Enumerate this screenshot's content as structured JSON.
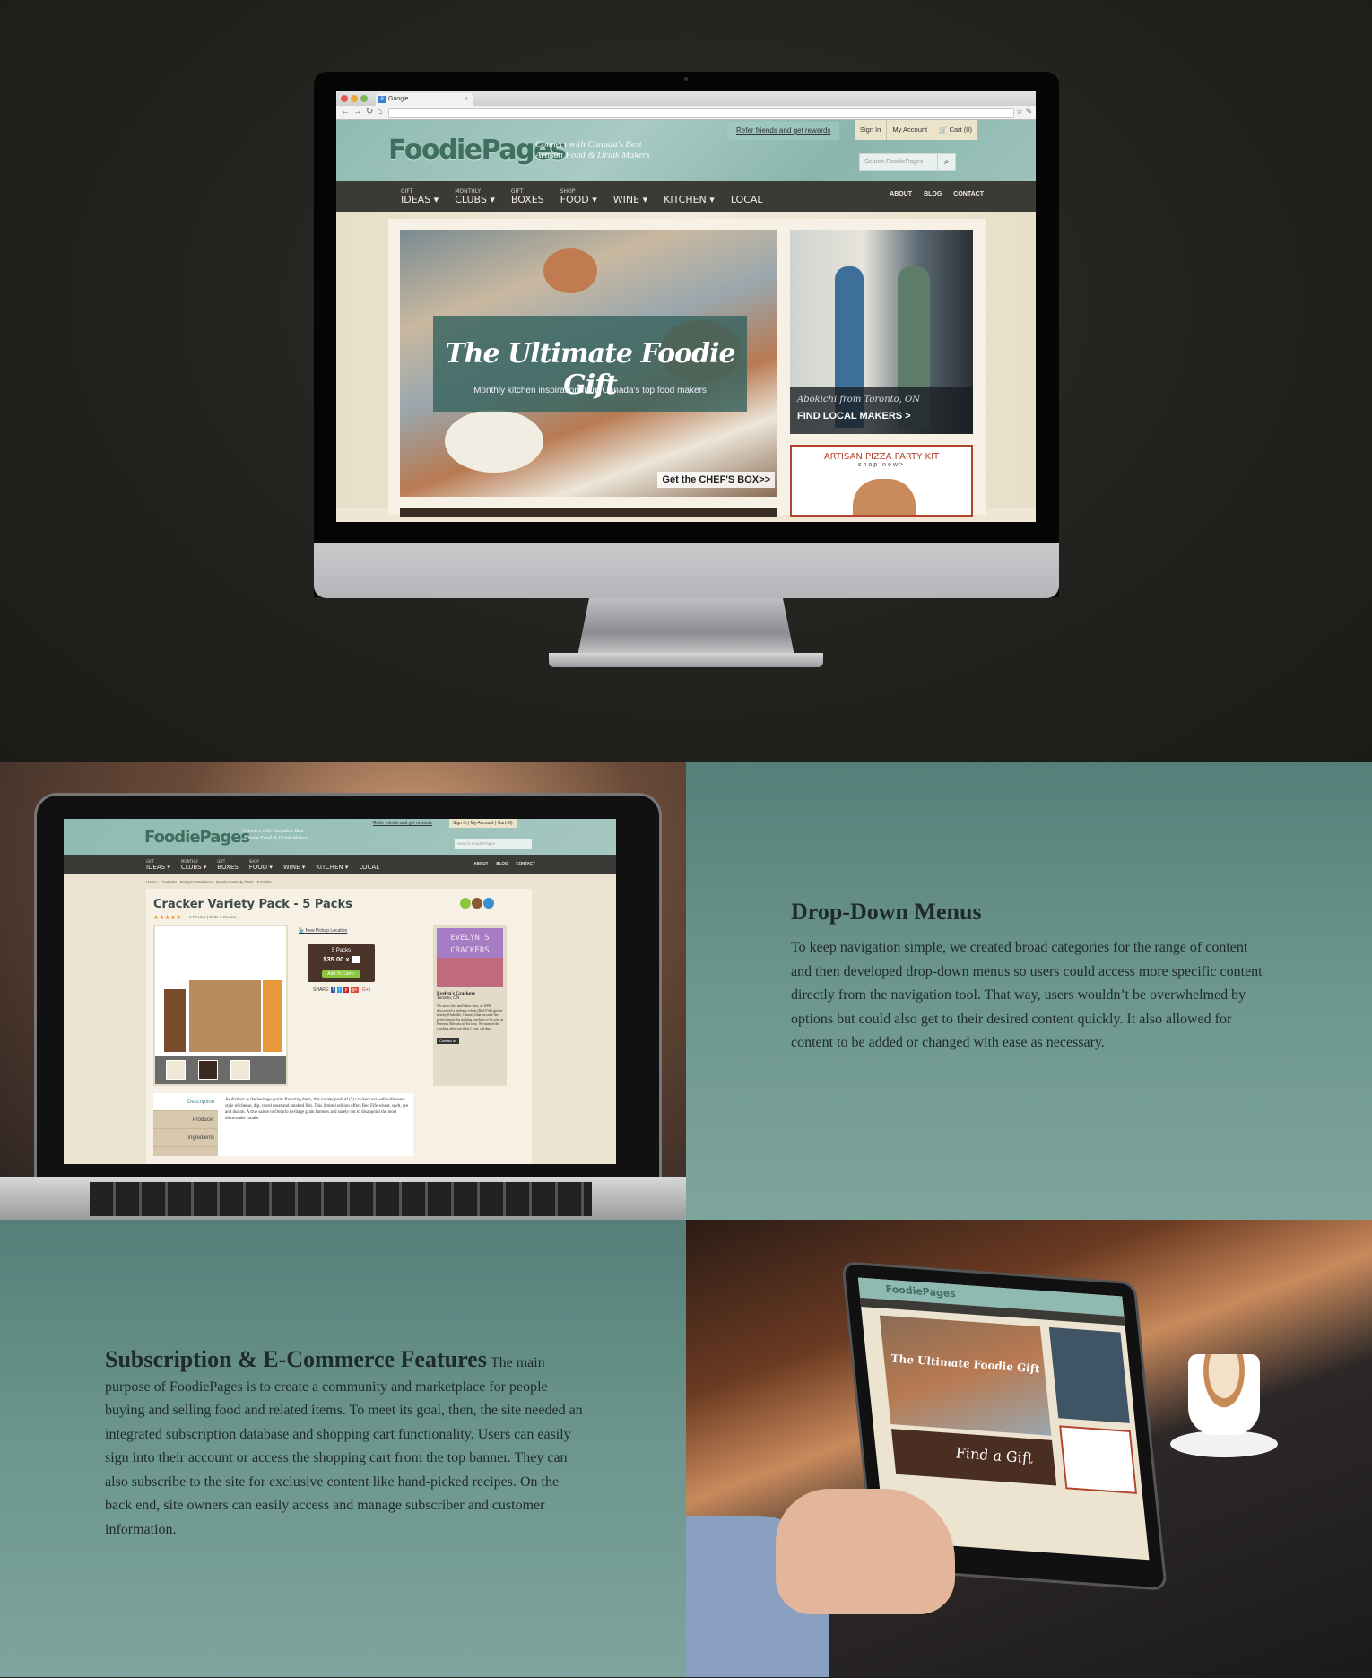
{
  "browser": {
    "tab_title": "Google",
    "tab_icon": "google-favicon",
    "nav_buttons": [
      "back-icon",
      "forward-icon",
      "reload-icon",
      "home-icon"
    ],
    "url": ""
  },
  "site": {
    "logo": "FoodiePages",
    "tagline_line1": "Connect with Canada's Best",
    "tagline_line2": "Artisan Food & Drink Makers",
    "refer_link": "Refer friends and get rewards",
    "account_links": [
      "Sign In",
      "My Account",
      "Cart (0)"
    ],
    "cart_icon": "cart-icon",
    "search_placeholder": "Search FoodiePages",
    "nav": [
      {
        "small": "GIFT",
        "label": "IDEAS ▾"
      },
      {
        "small": "MONTHLY",
        "label": "CLUBS ▾"
      },
      {
        "small": "GIFT",
        "label": "BOXES"
      },
      {
        "small": "SHOP",
        "label": "FOOD ▾"
      },
      {
        "small": "",
        "label": "WINE ▾"
      },
      {
        "small": "",
        "label": "KITCHEN ▾"
      },
      {
        "small": "",
        "label": "LOCAL"
      }
    ],
    "nav_right": [
      "ABOUT",
      "BLOG",
      "CONTACT"
    ]
  },
  "hero": {
    "title": "The Ultimate Foodie Gift",
    "subtitle": "Monthly kitchen inspiration from Canada's top food makers",
    "cta": "Get the CHEF'S BOX>>"
  },
  "makers": {
    "script": "Abokichi from Toronto, ON",
    "cta": "FIND LOCAL MAKERS >"
  },
  "pizza": {
    "title": "ARTISAN PIZZA PARTY KIT",
    "sub": "shop now>"
  },
  "product_page": {
    "breadcrumb": "Home › Products › Evelyn's Crackers › Cracker Variety Pack - 5 Packs",
    "title": "Cracker Variety Pack - 5 Packs",
    "stars": "★★★★★",
    "rating": 5,
    "reviews": "1 Review | Write a Review",
    "pickup": "New Pickup Location",
    "tag_packs": "5 Packs",
    "price": "$35.00 x",
    "add_to_cart": "Add To Cart »",
    "share_label": "SHARE:",
    "producer_logo": "EVELYN'S CRACKERS",
    "producer_name": "Evelyn's Crackers",
    "producer_location": "Toronto, ON",
    "producer_desc": "We are a chef and baker who, in 2008, discovered a heritage wheat (Red Fife) grown nearby (Oakville, Ontario) that became the perfect muse for making crackers to be sold at Farmers Markets in Toronto. We named the crackers after our then 1 year old dau",
    "contact_btn": "Contact us",
    "tabs": [
      "Description",
      "Producer",
      "Ingredients"
    ],
    "description": "As distinct as the heritage grains flavoring them, this variety pack of (5) crackers eat well with every style of cheese, dip, cured meat and smoked fish. This limited edition offers Red Fife wheat, spelt, rye and durum. A true salute to Ontario heritage grain farmers and surely not to disappoint the most discernable foodie."
  },
  "laptop2": {
    "logo": "FoodiePages",
    "hero": "The Ultimate Foodie Gift",
    "find_gift": "Find a Gift"
  },
  "sections": {
    "dropdown": {
      "heading": "Drop-Down Menus",
      "body": "To keep navigation simple, we created broad categories for the range of content and then developed drop-down menus so users could access more specific content directly from the navigation tool. That way, users wouldn’t be overwhelmed by options but could also get to their desired content quickly. It also allowed for content to be added or changed with ease as necessary."
    },
    "subscription": {
      "heading": "Subscription & E-Commerce Features",
      "body": "The main purpose of FoodiePages is to create a community and marketplace for people buying and selling food and related items. To meet its goal, then, the site needed an integrated subscription database and shopping cart functionality. Users can easily sign into their account or access the shopping cart from the top banner. They can also subscribe to the site for exclusive content like hand-picked recipes. On the back end, site owners can easily access and manage subscriber and customer information."
    }
  },
  "colors": {
    "teal_bg": "#6c968e",
    "header_teal": "#9cc3bb",
    "nav_dark": "#3b3a37",
    "accent_red": "#b4432e",
    "add_cart_green": "#8cc63f",
    "dark_bg": "#22211d"
  }
}
